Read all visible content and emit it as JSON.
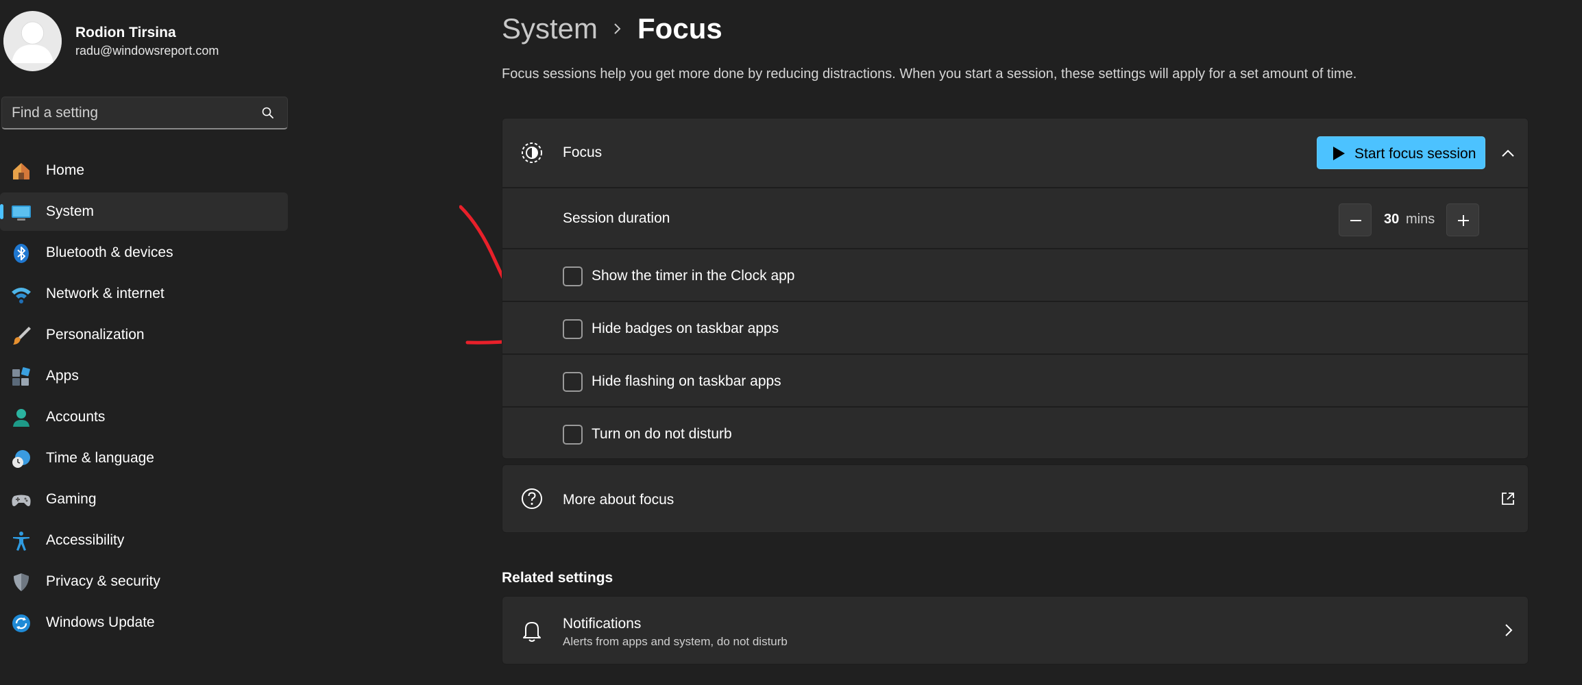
{
  "profile": {
    "name": "Rodion Tirsina",
    "email": "radu@windowsreport.com"
  },
  "search": {
    "placeholder": "Find a setting"
  },
  "sidebar": {
    "items": [
      {
        "label": "Home",
        "icon": "home-icon"
      },
      {
        "label": "System",
        "icon": "system-icon"
      },
      {
        "label": "Bluetooth & devices",
        "icon": "bluetooth-icon"
      },
      {
        "label": "Network & internet",
        "icon": "wifi-icon"
      },
      {
        "label": "Personalization",
        "icon": "brush-icon"
      },
      {
        "label": "Apps",
        "icon": "apps-icon"
      },
      {
        "label": "Accounts",
        "icon": "accounts-icon"
      },
      {
        "label": "Time & language",
        "icon": "clock-globe-icon"
      },
      {
        "label": "Gaming",
        "icon": "gamepad-icon"
      },
      {
        "label": "Accessibility",
        "icon": "accessibility-icon"
      },
      {
        "label": "Privacy & security",
        "icon": "shield-icon"
      },
      {
        "label": "Windows Update",
        "icon": "update-icon"
      }
    ],
    "active_index": 1
  },
  "breadcrumb": {
    "parent": "System",
    "current": "Focus"
  },
  "description": "Focus sessions help you get more done by reducing distractions. When you start a session, these settings will apply for a set amount of time.",
  "focus": {
    "title": "Focus",
    "start_label": "Start focus session",
    "session_label": "Session duration",
    "duration_value": "30",
    "duration_unit": "mins",
    "options": [
      {
        "label": "Show the timer in the Clock app",
        "checked": false
      },
      {
        "label": "Hide badges on taskbar apps",
        "checked": false
      },
      {
        "label": "Hide flashing on taskbar apps",
        "checked": false
      },
      {
        "label": "Turn on do not disturb",
        "checked": false
      }
    ]
  },
  "more": {
    "label": "More about focus"
  },
  "related": {
    "heading": "Related settings",
    "notifications_title": "Notifications",
    "notifications_sub": "Alerts from apps and system, do not disturb"
  },
  "colors": {
    "background": "#202020",
    "card": "#2b2b2b",
    "accent": "#4cc2ff",
    "annotation": "#e8202a"
  }
}
